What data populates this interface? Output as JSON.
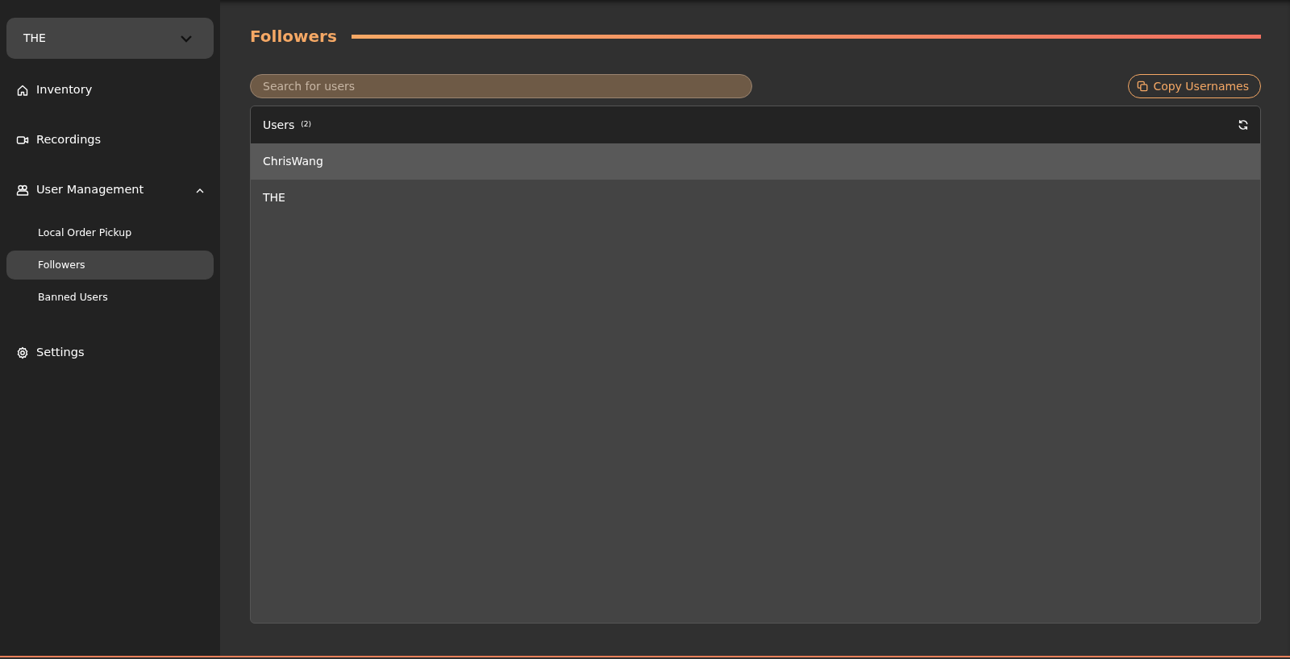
{
  "account": {
    "label": "THE",
    "expanded": false
  },
  "nav": [
    {
      "label": "Inventory",
      "selected": false
    },
    {
      "label": "Recordings",
      "selected": false
    },
    {
      "label": "User Management",
      "selected": false,
      "expanded": true,
      "children": [
        {
          "label": "Local Order Pickup",
          "selected": false
        },
        {
          "label": "Followers",
          "selected": true
        },
        {
          "label": "Banned Users",
          "selected": false
        }
      ]
    },
    {
      "label": "Settings",
      "selected": false
    }
  ],
  "page": {
    "title": "Followers"
  },
  "search": {
    "placeholder": "Search for users"
  },
  "copy_button": {
    "label": "Copy Usernames"
  },
  "users": {
    "title": "Users",
    "count": "(2)",
    "rows": [
      {
        "name": "ChrisWang",
        "selected": true
      },
      {
        "name": "THE",
        "selected": false
      }
    ]
  }
}
